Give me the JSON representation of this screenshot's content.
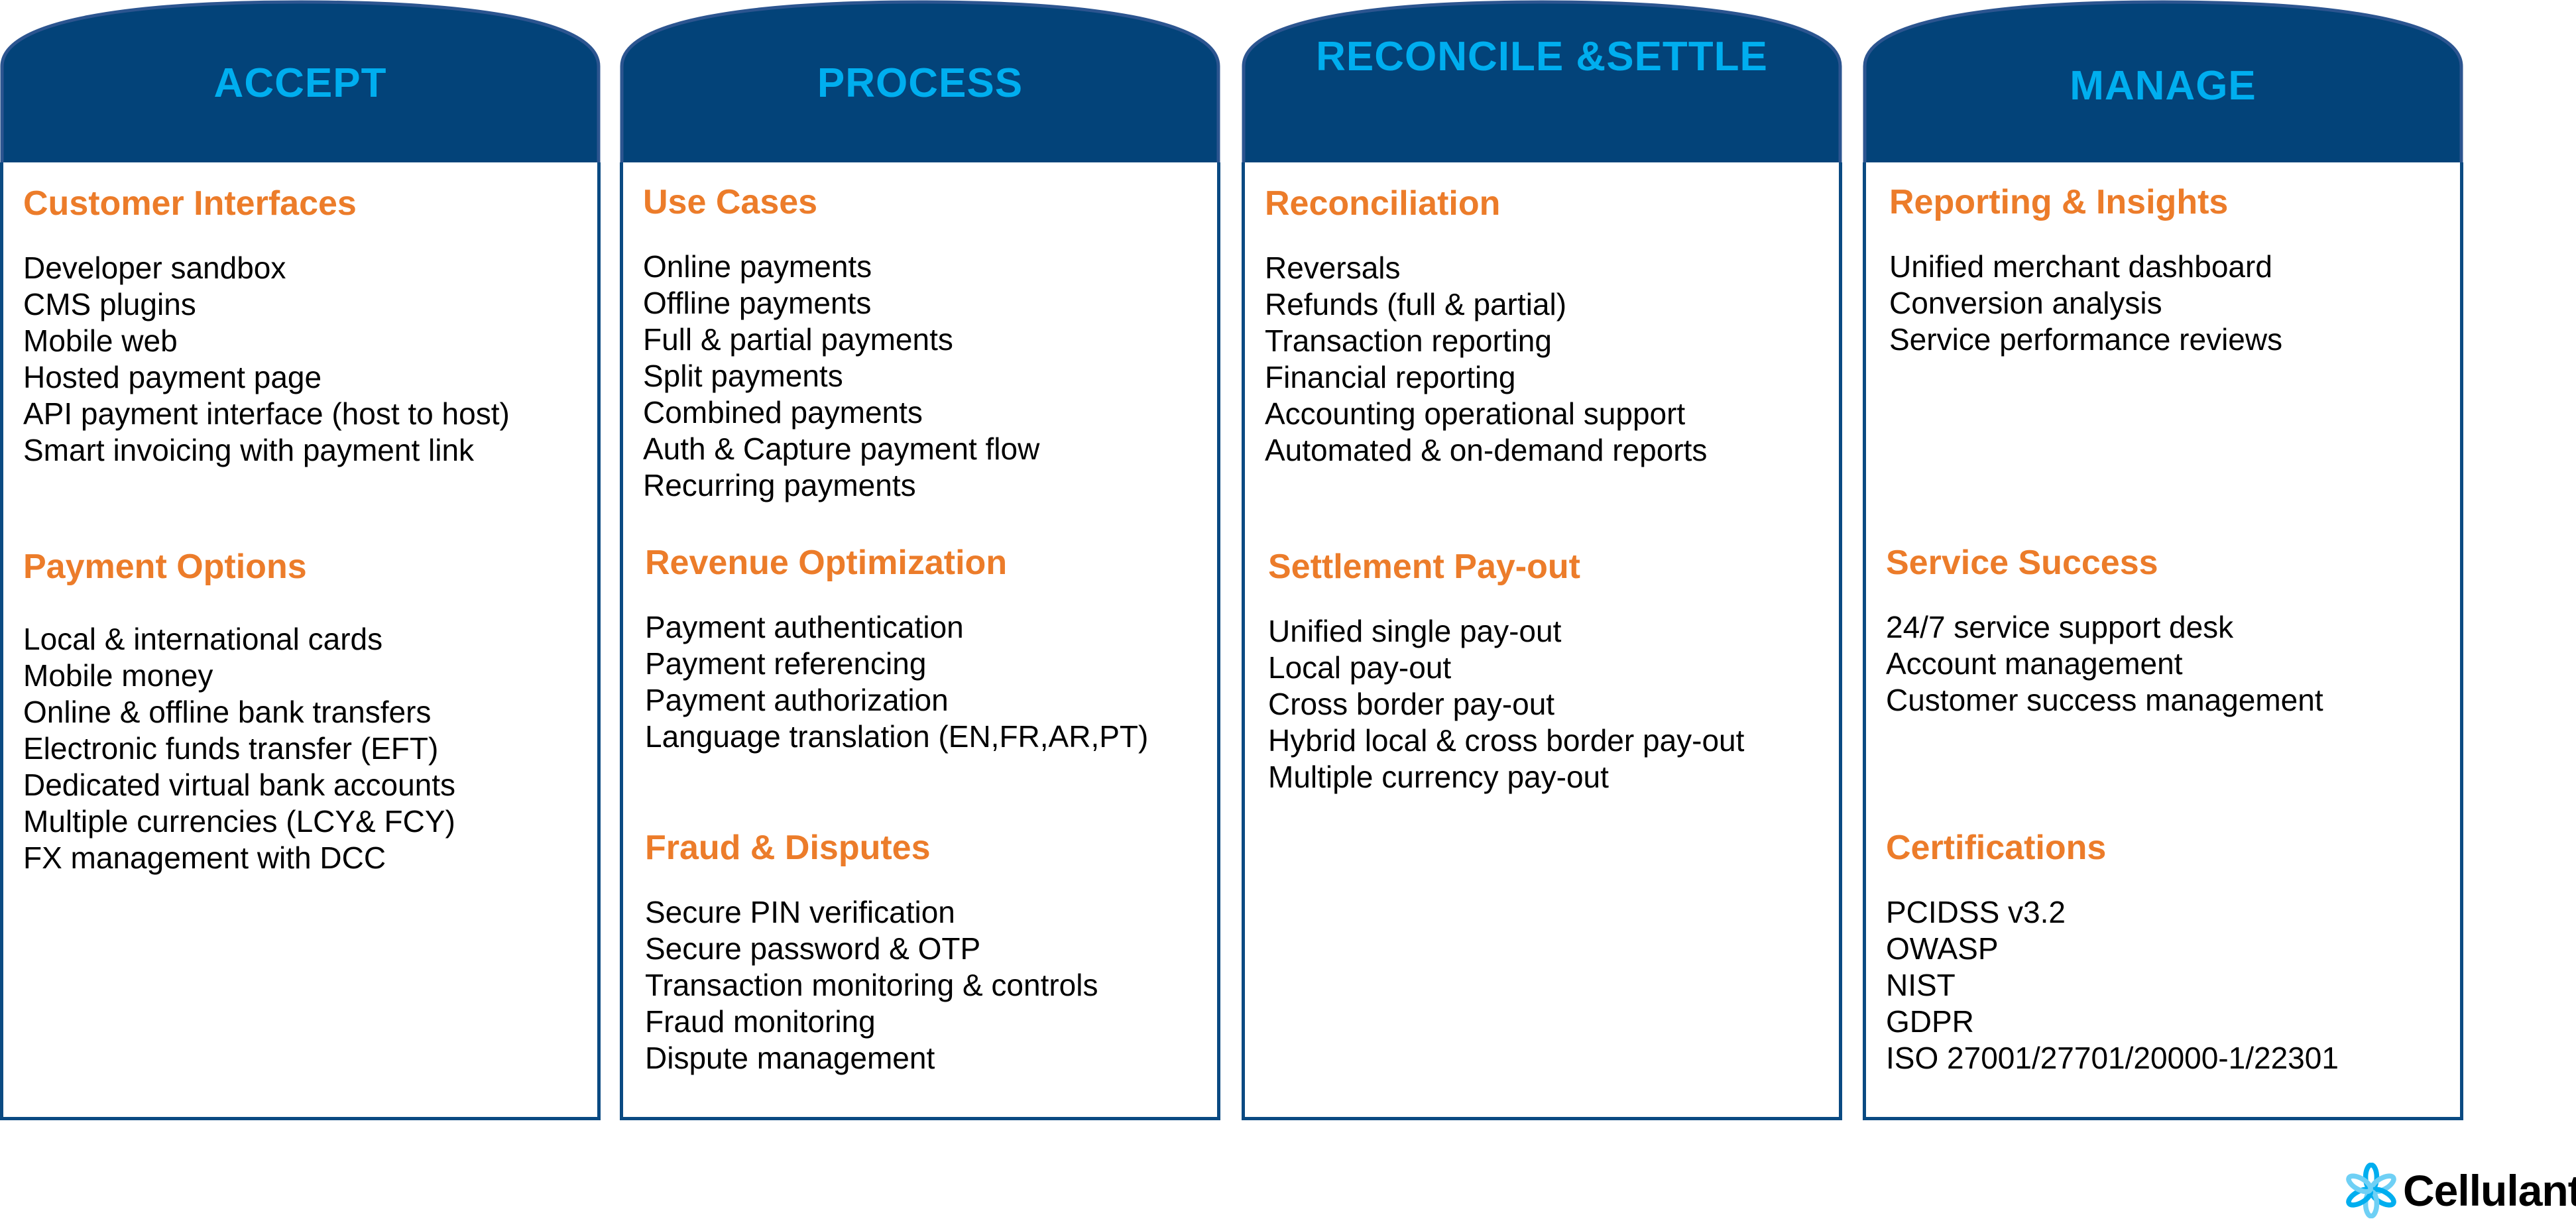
{
  "colors": {
    "header_fill": "#034379",
    "header_text": "#00aeef",
    "section_title": "#ec7c2a",
    "border": "#0a4a82",
    "logo_blue": "#00aeef"
  },
  "columns": [
    {
      "title_line1": "ACCEPT",
      "title_line2": "",
      "sections": [
        {
          "title": "Customer Interfaces",
          "items": [
            "Developer sandbox",
            "CMS plugins",
            "Mobile web",
            "Hosted payment page",
            "API payment interface (host to host)",
            "Smart invoicing with payment link"
          ]
        },
        {
          "title": "Payment Options",
          "items": [
            "Local & international cards",
            "Mobile money",
            "Online & offline bank transfers",
            "Electronic funds transfer (EFT)",
            "Dedicated virtual bank accounts",
            "Multiple currencies (LCY& FCY)",
            "FX management with DCC"
          ]
        }
      ]
    },
    {
      "title_line1": "PROCESS",
      "title_line2": "",
      "sections": [
        {
          "title": "Use Cases",
          "items": [
            "Online payments",
            "Offline payments",
            "Full & partial payments",
            "Split payments",
            "Combined payments",
            "Auth & Capture payment flow",
            "Recurring payments"
          ]
        },
        {
          "title": "Revenue Optimization",
          "items": [
            "Payment authentication",
            "Payment referencing",
            "Payment authorization",
            "Language translation (EN,FR,AR,PT)"
          ]
        },
        {
          "title": "Fraud & Disputes",
          "items": [
            "Secure PIN verification",
            "Secure password & OTP",
            "Transaction monitoring & controls",
            "Fraud monitoring",
            "Dispute management"
          ]
        }
      ]
    },
    {
      "title_line1": "RECONCILE &",
      "title_line2": "SETTLE",
      "sections": [
        {
          "title": "Reconciliation",
          "items": [
            "Reversals",
            "Refunds (full & partial)",
            "Transaction reporting",
            "Financial reporting",
            "Accounting operational support",
            "Automated & on-demand reports"
          ]
        },
        {
          "title": "Settlement Pay-out",
          "items": [
            "Unified single pay-out",
            "Local pay-out",
            "Cross border pay-out",
            "Hybrid local & cross border pay-out",
            "Multiple currency pay-out"
          ]
        }
      ]
    },
    {
      "title_line1": "MANAGE",
      "title_line2": "",
      "sections": [
        {
          "title": "Reporting & Insights",
          "items": [
            "Unified merchant dashboard",
            "Conversion analysis",
            "Service performance reviews"
          ]
        },
        {
          "title": "Service Success",
          "items": [
            "24/7 service support desk",
            "Account management",
            "Customer success management"
          ]
        },
        {
          "title": "Certifications",
          "items": [
            "PCIDSS v3.2",
            "OWASP",
            "NIST",
            "GDPR",
            "ISO 27001/27701/20000-1/22301"
          ]
        }
      ]
    }
  ],
  "logo": {
    "text": "Cellulant",
    "icon": "cellulant-flower-icon"
  }
}
